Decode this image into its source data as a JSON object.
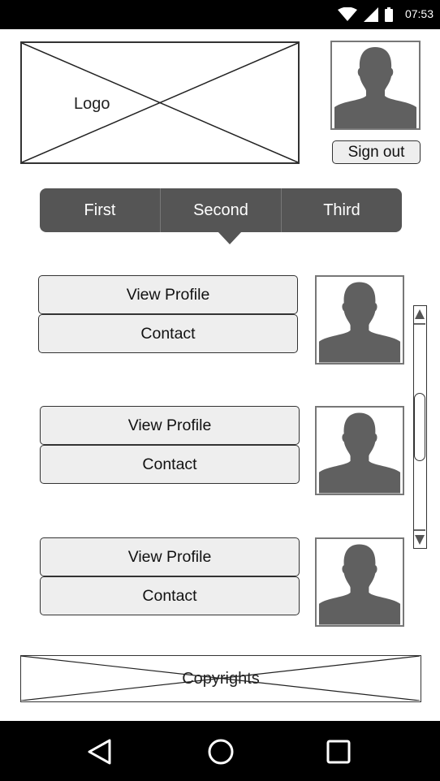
{
  "status_bar": {
    "time": "07:53",
    "icons": [
      "wifi-icon",
      "signal-icon",
      "battery-icon"
    ]
  },
  "header": {
    "logo_label": "Logo",
    "signout_label": "Sign out"
  },
  "tabs": [
    {
      "label": "First"
    },
    {
      "label": "Second"
    },
    {
      "label": "Third"
    }
  ],
  "selected_tab": "Second",
  "list": [
    {
      "view_label": "View Profile",
      "contact_label": "Contact"
    },
    {
      "view_label": "View Profile",
      "contact_label": "Contact"
    },
    {
      "view_label": "View Profile",
      "contact_label": "Contact"
    }
  ],
  "footer": {
    "label": "Copyrights"
  },
  "nav": [
    "back-icon",
    "home-icon",
    "recents-icon"
  ],
  "colors": {
    "tab_bar": "#555555",
    "button_fill": "#eeeeee",
    "bars": "#000000"
  }
}
